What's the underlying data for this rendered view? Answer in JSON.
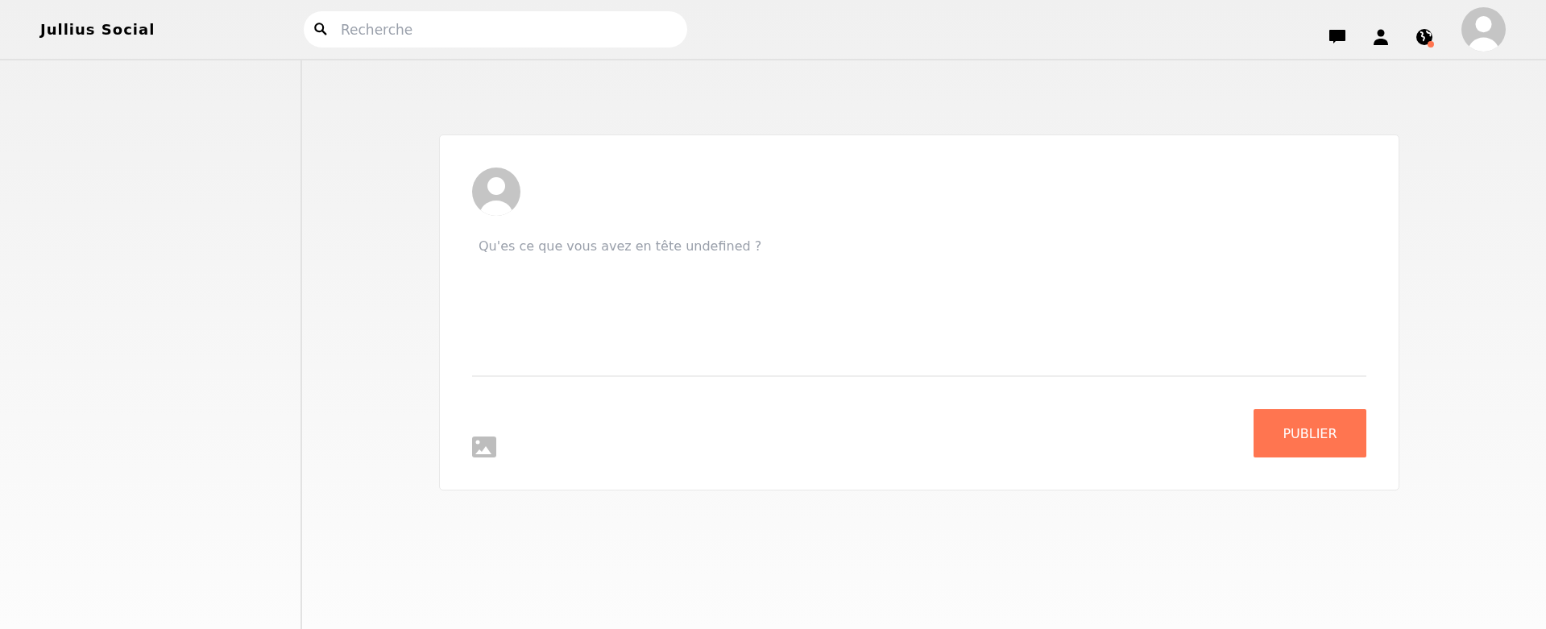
{
  "header": {
    "logo": "Jullius Social",
    "search": {
      "placeholder": "Recherche"
    },
    "icons": [
      {
        "kind": "chat",
        "notification": false
      },
      {
        "kind": "person",
        "notification": false
      },
      {
        "kind": "globe",
        "notification": true
      }
    ]
  },
  "composer": {
    "placeholder": "Qu'es ce que vous avez en tête undefined ?",
    "publish_button": "PUBLIER"
  }
}
